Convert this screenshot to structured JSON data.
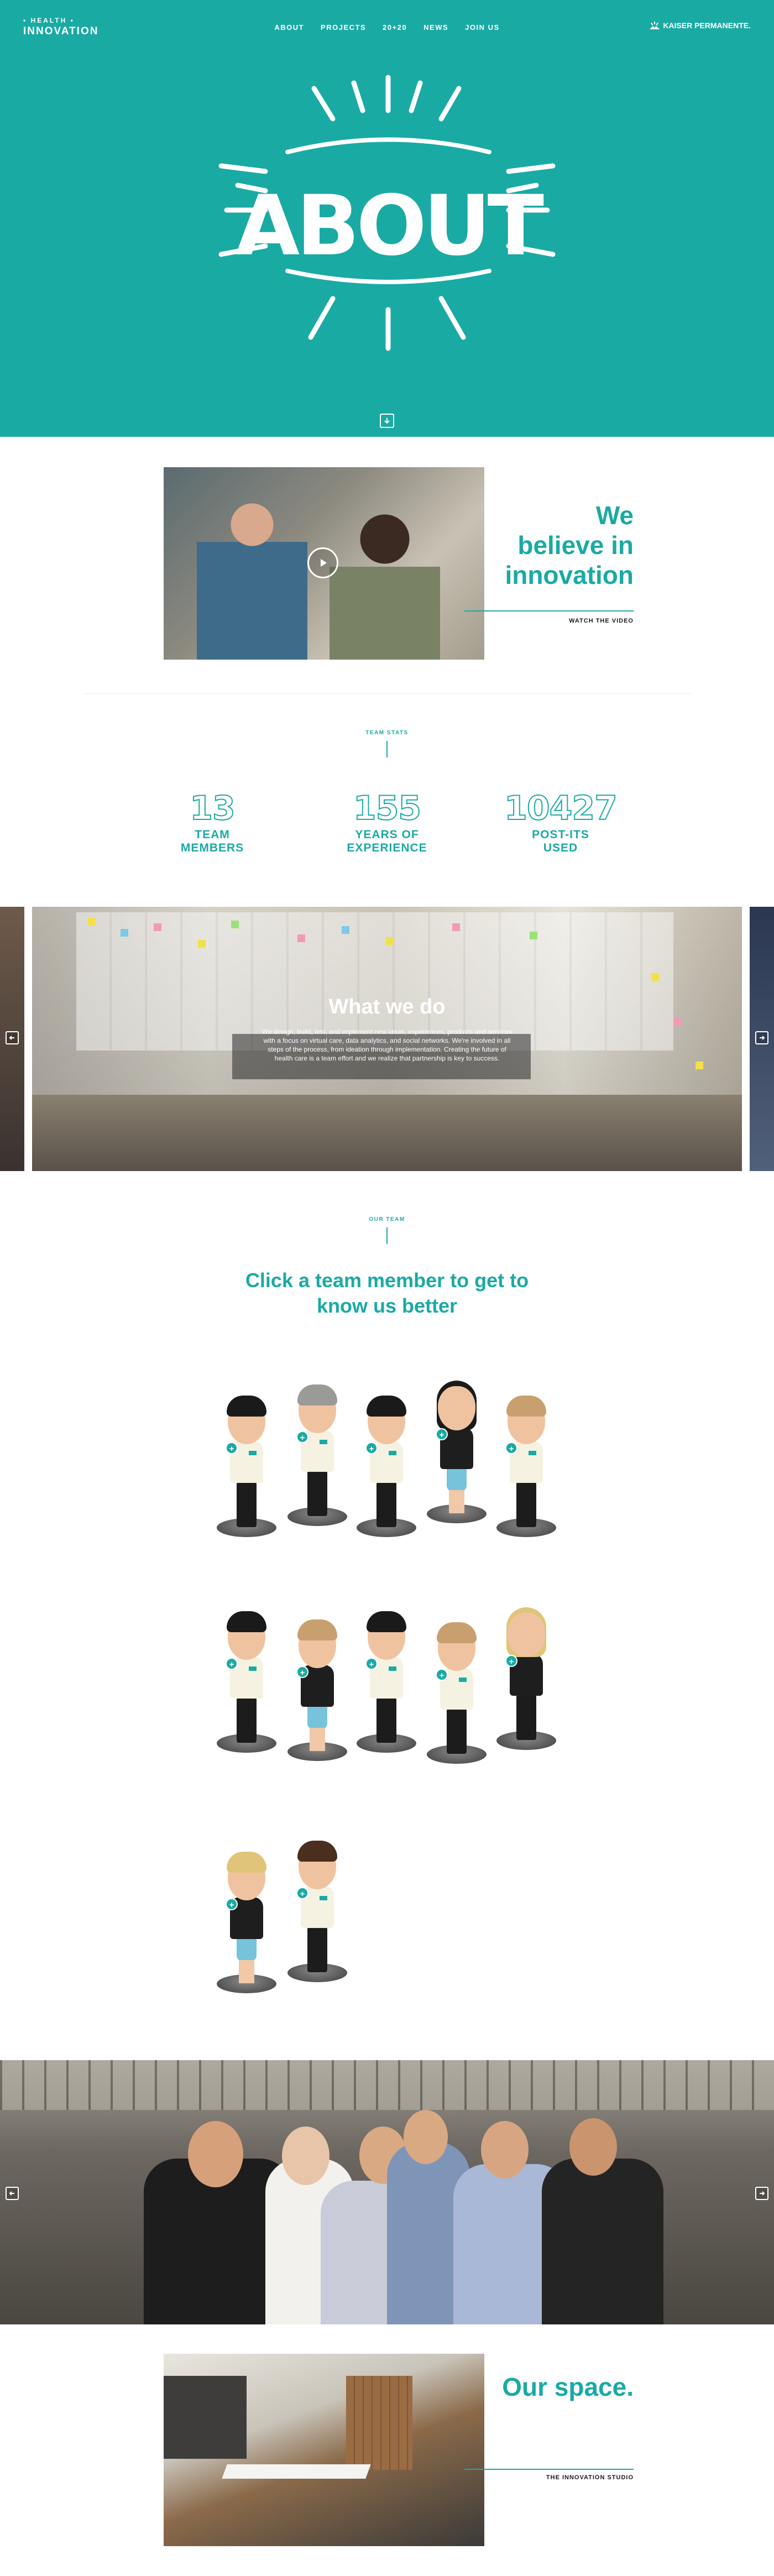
{
  "header": {
    "logo_small": "• HEALTH •",
    "logo_big": "INNOVATION",
    "nav": [
      "ABOUT",
      "PROJECTS",
      "20+20",
      "NEWS",
      "JOIN US"
    ],
    "partner_logo": "KAISER PERMANENTE."
  },
  "hero": {
    "title": "ABOUT",
    "background_color": "#1aaaa4"
  },
  "believe": {
    "title_lines": [
      "We",
      "believe in",
      "innovation"
    ],
    "link": "WATCH THE VIDEO"
  },
  "stats": {
    "label": "TEAM STATS",
    "items": [
      {
        "value": "13",
        "label_1": "TEAM",
        "label_2": "MEMBERS"
      },
      {
        "value": "155",
        "label_1": "YEARS OF",
        "label_2": "EXPERIENCE"
      },
      {
        "value": "10427",
        "label_1": "POST-ITS",
        "label_2": "USED"
      }
    ]
  },
  "what_we_do": {
    "title": "What we do",
    "text": "We design, build, test, and implement new ideas, experiences, products and services with a focus on virtual care, data analytics, and social networks. We're involved in all steps of the process, from ideation through implementation. Creating the future of health care is a team effort and we realize that partnership is key to success."
  },
  "team": {
    "label": "OUR TEAM",
    "heading_line1": "Click a team member to get to",
    "heading_line2": "know us better",
    "badge": "+"
  },
  "space": {
    "title": "Our space.",
    "link": "THE INNOVATION STUDIO"
  },
  "colors": {
    "accent": "#1aaaa4",
    "text_dark": "#1a1a1a",
    "background": "#ffffff"
  }
}
